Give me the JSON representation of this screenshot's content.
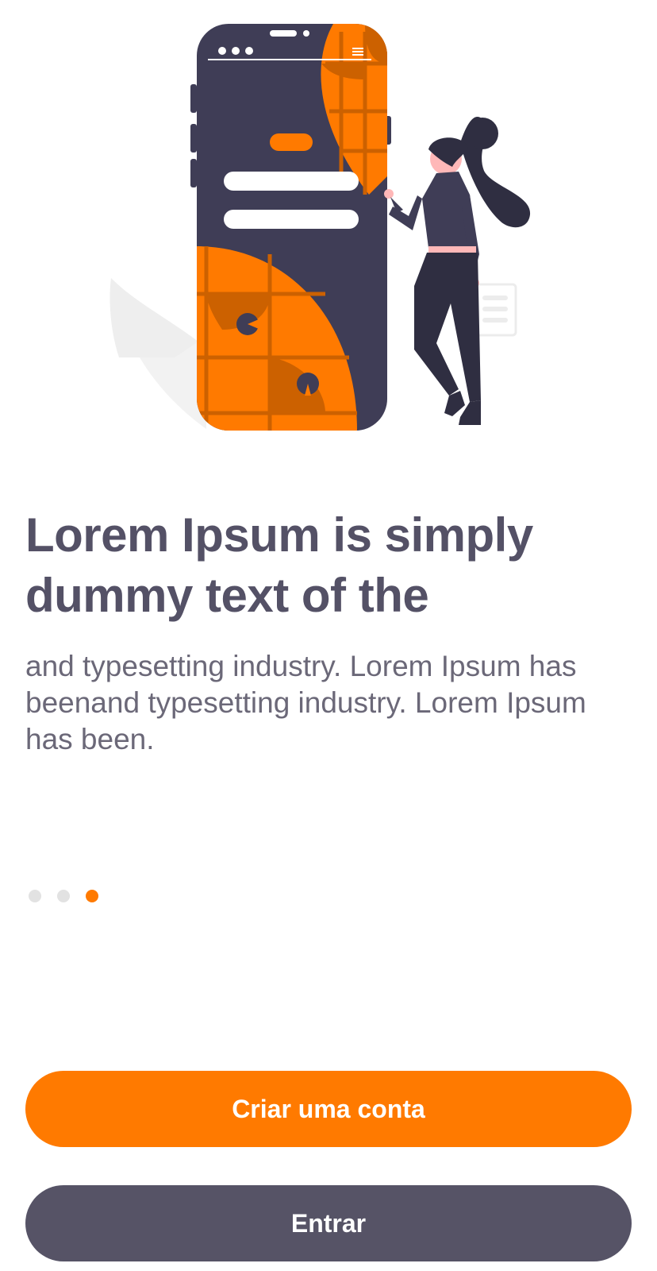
{
  "onboarding": {
    "headline": "Lorem Ipsum is simply dummy text of the",
    "body": "and typesetting industry. Lorem Ipsum has beenand typesetting industry. Lorem Ipsum has been.",
    "page_count": 3,
    "current_page": 3
  },
  "actions": {
    "create_account_label": "Criar uma conta",
    "login_label": "Entrar"
  },
  "colors": {
    "accent": "#ff7a00",
    "dark": "#565366",
    "text_primary": "#545166",
    "text_secondary": "#6b6878",
    "dot_inactive": "#e2e2e2"
  },
  "illustration": {
    "icon": "woman-with-phone-illustration"
  }
}
